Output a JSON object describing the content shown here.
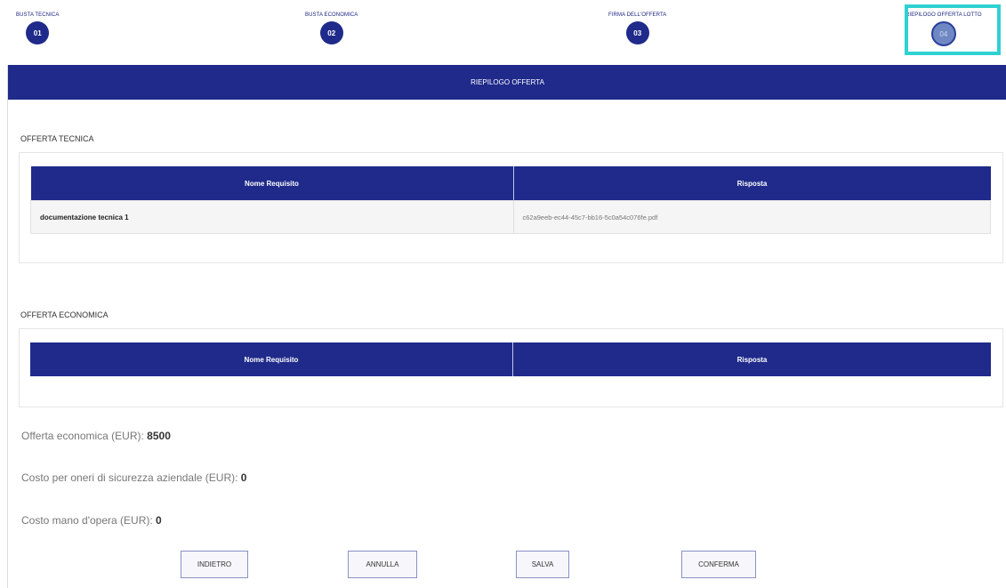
{
  "stepper": {
    "steps": [
      {
        "label": "BUSTA TECNICA",
        "number": "01"
      },
      {
        "label": "BUSTA ECONOMICA",
        "number": "02"
      },
      {
        "label": "FIRMA DELL'OFFERTA",
        "number": "03"
      },
      {
        "label": "RIEPILOGO OFFERTA LOTTO",
        "number": "04"
      }
    ]
  },
  "header": {
    "title": "RIEPILOGO OFFERTA"
  },
  "offerta_tecnica": {
    "title": "OFFERTA TECNICA",
    "columns": [
      "Nome Requisito",
      "Risposta"
    ],
    "rows": [
      {
        "nome": "documentazione tecnica 1",
        "risposta": "c62a9eeb-ec44-45c7-bb16-5c0a54c076fe.pdf"
      }
    ]
  },
  "offerta_economica": {
    "title": "OFFERTA ECONOMICA",
    "columns": [
      "Nome Requisito",
      "Risposta"
    ]
  },
  "summary": {
    "offerta_label": "Offerta economica (EUR):",
    "offerta_value": "8500",
    "sicurezza_label": "Costo per oneri di sicurezza aziendale (EUR):",
    "sicurezza_value": "0",
    "manodopera_label": "Costo mano d'opera (EUR):",
    "manodopera_value": "0"
  },
  "buttons": {
    "indietro": "INDIETRO",
    "annulla": "ANNULLA",
    "salva": "SALVA",
    "conferma": "CONFERMA"
  },
  "colors": {
    "primary": "#1f2a8a",
    "active_step": "#6f88c4",
    "highlight": "#2fd1d1"
  }
}
